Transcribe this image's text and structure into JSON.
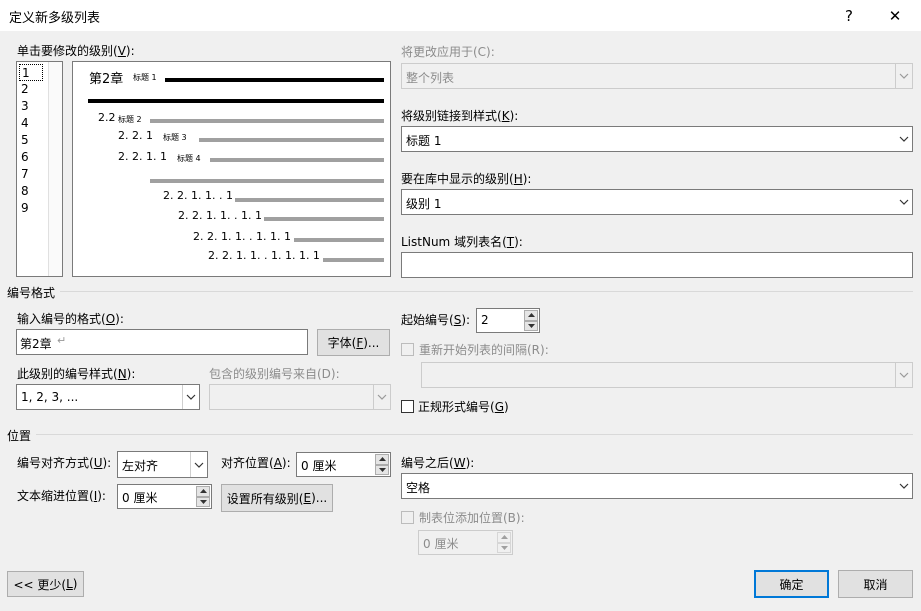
{
  "window": {
    "title": "定义新多级列表",
    "help_label": "?",
    "close_label": "✕"
  },
  "levels": {
    "label_text": "单击要修改的级别(",
    "label_key": "V",
    "label_end": "):",
    "items": [
      "1",
      "2",
      "3",
      "4",
      "5",
      "6",
      "7",
      "8",
      "9"
    ]
  },
  "preview": {
    "l1_number": "第2章",
    "l1_style": "标题 1",
    "l2_number": "2.2",
    "l2_style": "标题 2",
    "l3_number": "2. 2. 1",
    "l3_style": "标题 3",
    "l4_number": "2. 2. 1. 1",
    "l4_style": "标题 4",
    "l6_number": "2. 2. 1. 1. . 1",
    "l7_number": "2. 2. 1. 1. . 1. 1",
    "l8_number": "2. 2. 1. 1. . 1. 1. 1",
    "l9_number": "2. 2. 1. 1. . 1. 1. 1. 1"
  },
  "apply_to": {
    "label": "将更改应用于(C):",
    "value": "整个列表"
  },
  "link_style": {
    "label_text": "将级别链接到样式(",
    "label_key": "K",
    "label_end": "):",
    "value": "标题 1"
  },
  "gallery_level": {
    "label_text": "要在库中显示的级别(",
    "label_key": "H",
    "label_end": "):",
    "value": "级别 1"
  },
  "listnum": {
    "label_text": "ListNum 域列表名(",
    "label_key": "T",
    "label_end": "):",
    "value": ""
  },
  "number_format_section": {
    "heading": "编号格式",
    "format_label_text": "输入编号的格式(",
    "format_label_key": "O",
    "format_label_end": "):",
    "format_value": "第2章",
    "font_button_text": "字体(",
    "font_button_key": "F",
    "font_button_end": ")...",
    "style_label_text": "此级别的编号样式(",
    "style_label_key": "N",
    "style_label_end": "):",
    "style_value": "1, 2, 3, ...",
    "include_label": "包含的级别编号来自(D):",
    "include_value": "",
    "start_label_text": "起始编号(",
    "start_label_key": "S",
    "start_label_end": "):",
    "start_value": "2",
    "restart_label": "重新开始列表的间隔(R):",
    "restart_value": "",
    "legal_label_text": "正规形式编号(",
    "legal_label_key": "G",
    "legal_label_end": ")"
  },
  "position_section": {
    "heading": "位置",
    "align_label_text": "编号对齐方式(",
    "align_label_key": "U",
    "align_label_end": "):",
    "align_value": "左对齐",
    "aligned_at_label_text": "对齐位置(",
    "aligned_at_label_key": "A",
    "aligned_at_label_end": "):",
    "aligned_at_value": "0 厘米",
    "indent_label_text": "文本缩进位置(",
    "indent_label_key": "I",
    "indent_label_end": "):",
    "indent_value": "0 厘米",
    "set_all_text": "设置所有级别(",
    "set_all_key": "E",
    "set_all_end": ")...",
    "follow_label_text": "编号之后(",
    "follow_label_key": "W",
    "follow_label_end": "):",
    "follow_value": "空格",
    "tab_label": "制表位添加位置(B):",
    "tab_value": "0 厘米"
  },
  "footer": {
    "less_text": "<< 更少(",
    "less_key": "L",
    "less_end": ")",
    "ok": "确定",
    "cancel": "取消"
  }
}
